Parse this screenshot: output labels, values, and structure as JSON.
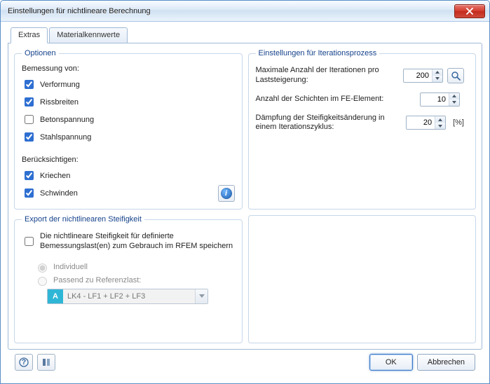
{
  "window": {
    "title": "Einstellungen für nichtlineare Berechnung"
  },
  "tabs": {
    "extras": "Extras",
    "materials": "Materialkennwerte"
  },
  "options": {
    "legend": "Optionen",
    "bemessung_label": "Bemessung von:",
    "verformung": "Verformung",
    "rissbreiten": "Rissbreiten",
    "betonspannung": "Betonspannung",
    "stahlspannung": "Stahlspannung",
    "beruecksichtigen_label": "Berücksichtigen:",
    "kriechen": "Kriechen",
    "schwinden": "Schwinden"
  },
  "iteration": {
    "legend": "Einstellungen für Iterationsprozess",
    "max_iter_label": "Maximale Anzahl der Iterationen pro Laststeigerung:",
    "max_iter_value": "200",
    "layers_label": "Anzahl der Schichten im FE-Element:",
    "layers_value": "10",
    "damping_label": "Dämpfung der Steifigkeitsänderung in einem Iterationszyklus:",
    "damping_value": "20",
    "damping_unit": "[%]"
  },
  "export": {
    "legend": "Export der nichtlinearen Steifigkeit",
    "store_label": "Die nichtlineare Steifigkeit für definierte Bemessungslast(en) zum Gebrauch im RFEM speichern",
    "radio_individuell": "Individuell",
    "radio_passend": "Passend zu Referenzlast:",
    "combo_badge": "A",
    "combo_text": "LK4 - LF1 + LF2 + LF3"
  },
  "buttons": {
    "ok": "OK",
    "cancel": "Abbrechen"
  }
}
